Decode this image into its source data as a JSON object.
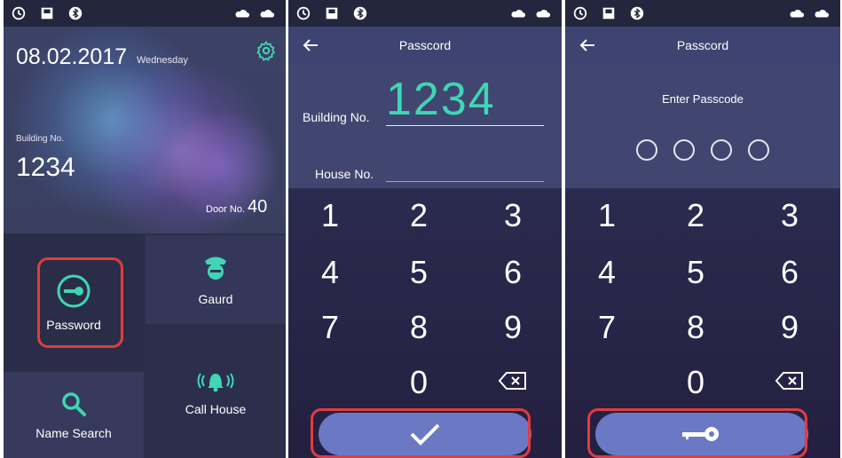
{
  "colors": {
    "accent": "#3fd6b4",
    "highlight": "#e23c3c",
    "button": "#6b78c4"
  },
  "home": {
    "date": "08.02.2017",
    "weekday": "Wednesday",
    "building_label": "Building No.",
    "building_value": "1234",
    "door_label": "Door No.",
    "door_value": "40",
    "tiles": {
      "password": "Password",
      "guard": "Gaurd",
      "name_search": "Name Search",
      "call_house": "Call House"
    }
  },
  "entry": {
    "title": "Passcord",
    "building_label": "Building No.",
    "building_value": "1234",
    "house_label": "House No.",
    "keys": [
      "1",
      "2",
      "3",
      "4",
      "5",
      "6",
      "7",
      "8",
      "9",
      "0"
    ],
    "confirm_icon": "check-icon"
  },
  "passcode": {
    "title": "Passcord",
    "prompt": "Enter Passcode",
    "keys": [
      "1",
      "2",
      "3",
      "4",
      "5",
      "6",
      "7",
      "8",
      "9",
      "0"
    ],
    "unlock_icon": "key-icon"
  }
}
